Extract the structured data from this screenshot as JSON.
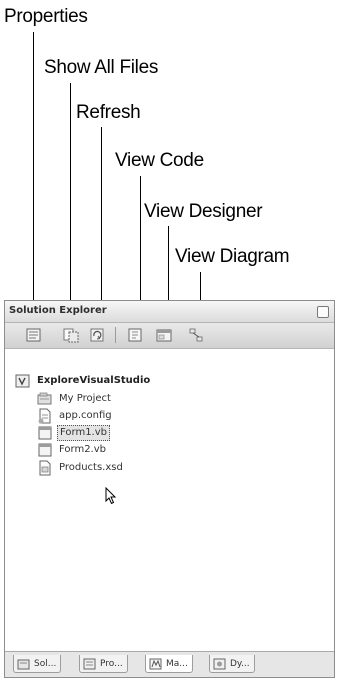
{
  "callouts": {
    "properties": "Properties",
    "show_all_files": "Show All Files",
    "refresh": "Refresh",
    "view_code": "View Code",
    "view_designer": "View Designer",
    "view_diagram": "View Diagram"
  },
  "panel": {
    "title": "Solution Explorer"
  },
  "tree": {
    "root": "ExploreVisualStudio",
    "items": [
      {
        "label": "My Project",
        "icon": "my-project-icon"
      },
      {
        "label": "app.config",
        "icon": "config-file-icon"
      },
      {
        "label": "Form1.vb",
        "icon": "form-file-icon",
        "selected": true
      },
      {
        "label": "Form2.vb",
        "icon": "form-file-icon"
      },
      {
        "label": "Products.xsd",
        "icon": "dataset-file-icon"
      }
    ]
  },
  "tabs": [
    {
      "label": "Sol...",
      "icon": "solution-explorer-icon"
    },
    {
      "label": "Pro...",
      "icon": "properties-icon"
    },
    {
      "label": "Ma...",
      "icon": "macro-explorer-icon",
      "active": true
    },
    {
      "label": "Dy...",
      "icon": "dynamic-help-icon"
    }
  ]
}
